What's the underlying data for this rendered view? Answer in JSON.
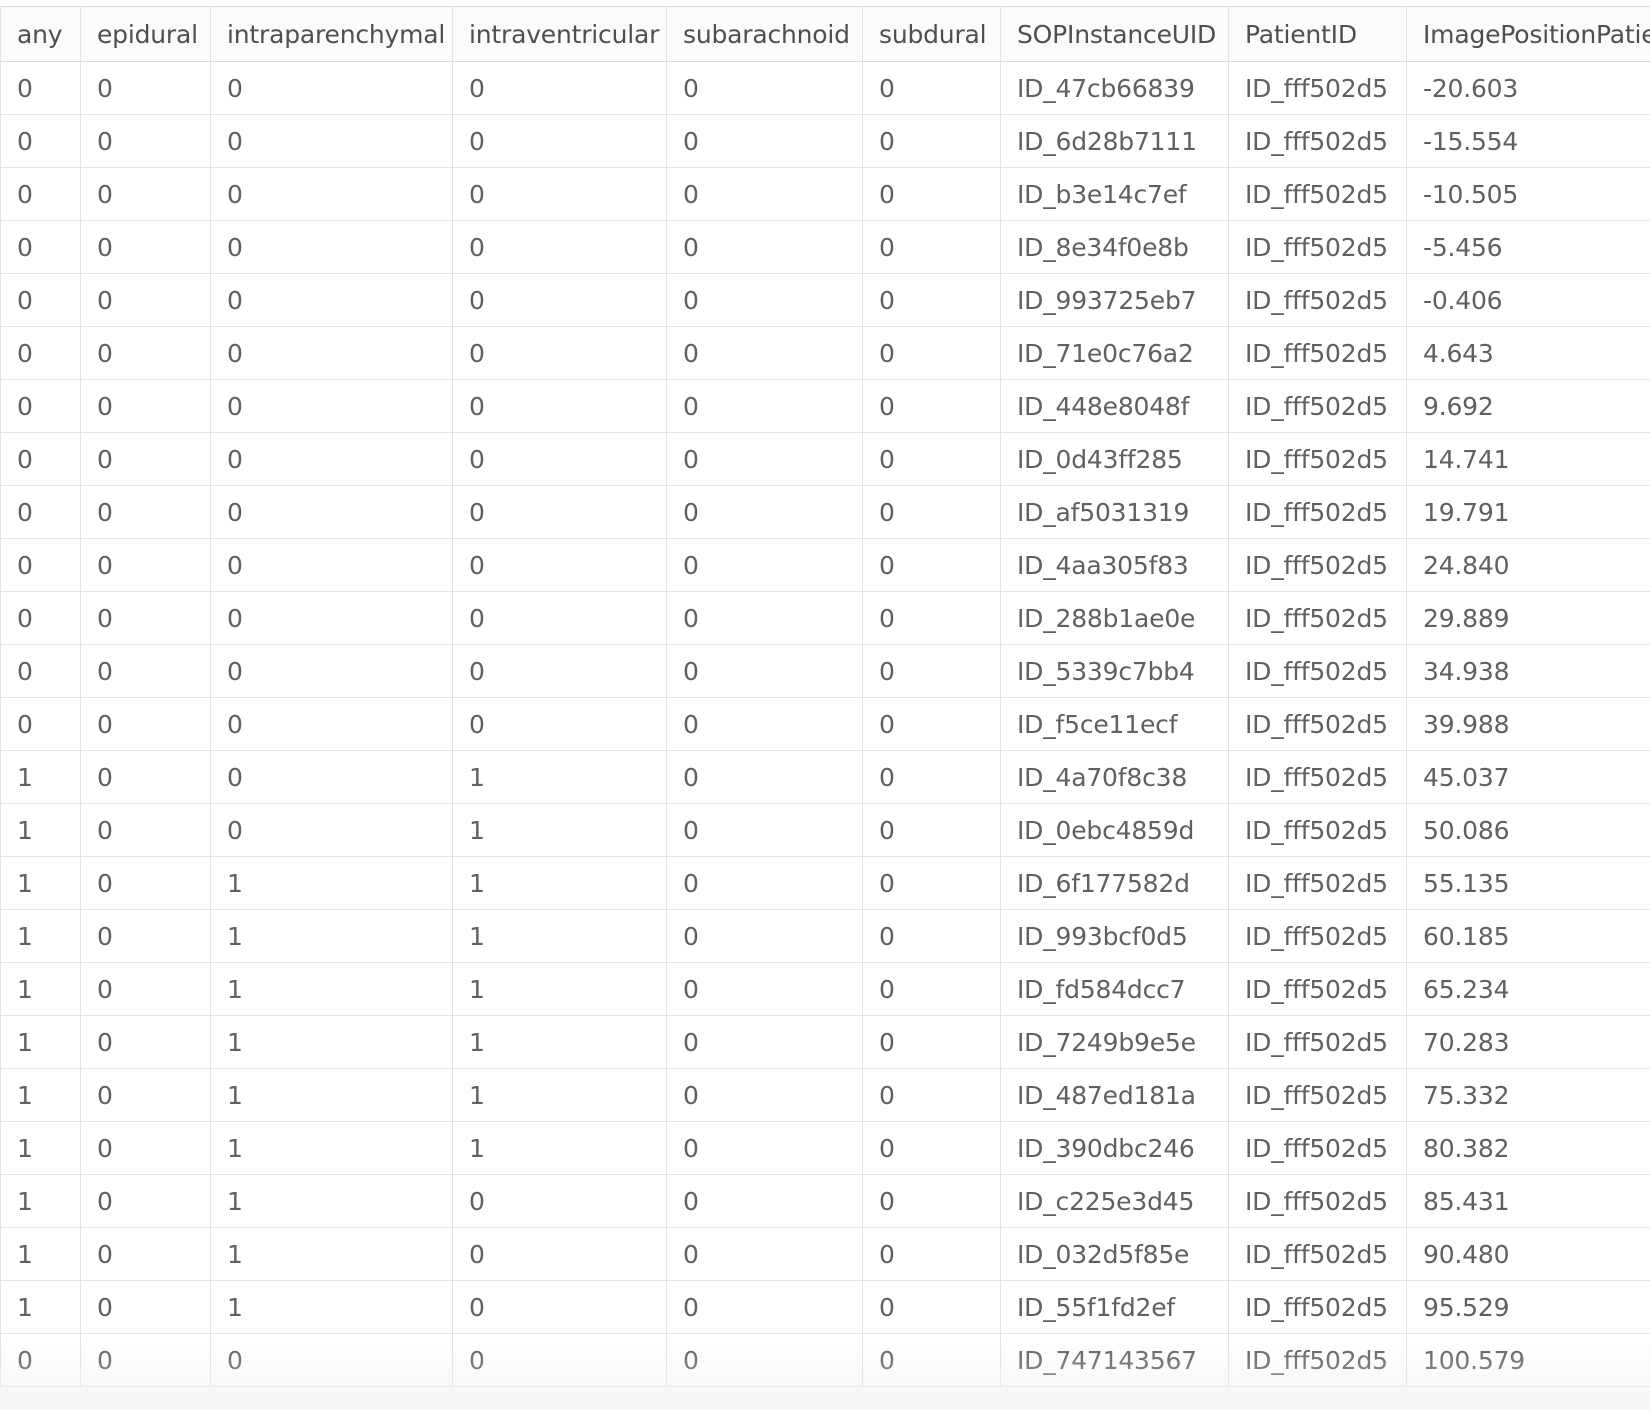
{
  "table": {
    "columns": [
      "any",
      "epidural",
      "intraparenchymal",
      "intraventricular",
      "subarachnoid",
      "subdural",
      "SOPInstanceUID",
      "PatientID",
      "ImagePositionPatie"
    ],
    "rows": [
      [
        "0",
        "0",
        "0",
        "0",
        "0",
        "0",
        "ID_47cb66839",
        "ID_fff502d5",
        "-20.603"
      ],
      [
        "0",
        "0",
        "0",
        "0",
        "0",
        "0",
        "ID_6d28b7111",
        "ID_fff502d5",
        "-15.554"
      ],
      [
        "0",
        "0",
        "0",
        "0",
        "0",
        "0",
        "ID_b3e14c7ef",
        "ID_fff502d5",
        "-10.505"
      ],
      [
        "0",
        "0",
        "0",
        "0",
        "0",
        "0",
        "ID_8e34f0e8b",
        "ID_fff502d5",
        "-5.456"
      ],
      [
        "0",
        "0",
        "0",
        "0",
        "0",
        "0",
        "ID_993725eb7",
        "ID_fff502d5",
        "-0.406"
      ],
      [
        "0",
        "0",
        "0",
        "0",
        "0",
        "0",
        "ID_71e0c76a2",
        "ID_fff502d5",
        "4.643"
      ],
      [
        "0",
        "0",
        "0",
        "0",
        "0",
        "0",
        "ID_448e8048f",
        "ID_fff502d5",
        "9.692"
      ],
      [
        "0",
        "0",
        "0",
        "0",
        "0",
        "0",
        "ID_0d43ff285",
        "ID_fff502d5",
        "14.741"
      ],
      [
        "0",
        "0",
        "0",
        "0",
        "0",
        "0",
        "ID_af5031319",
        "ID_fff502d5",
        "19.791"
      ],
      [
        "0",
        "0",
        "0",
        "0",
        "0",
        "0",
        "ID_4aa305f83",
        "ID_fff502d5",
        "24.840"
      ],
      [
        "0",
        "0",
        "0",
        "0",
        "0",
        "0",
        "ID_288b1ae0e",
        "ID_fff502d5",
        "29.889"
      ],
      [
        "0",
        "0",
        "0",
        "0",
        "0",
        "0",
        "ID_5339c7bb4",
        "ID_fff502d5",
        "34.938"
      ],
      [
        "0",
        "0",
        "0",
        "0",
        "0",
        "0",
        "ID_f5ce11ecf",
        "ID_fff502d5",
        "39.988"
      ],
      [
        "1",
        "0",
        "0",
        "1",
        "0",
        "0",
        "ID_4a70f8c38",
        "ID_fff502d5",
        "45.037"
      ],
      [
        "1",
        "0",
        "0",
        "1",
        "0",
        "0",
        "ID_0ebc4859d",
        "ID_fff502d5",
        "50.086"
      ],
      [
        "1",
        "0",
        "1",
        "1",
        "0",
        "0",
        "ID_6f177582d",
        "ID_fff502d5",
        "55.135"
      ],
      [
        "1",
        "0",
        "1",
        "1",
        "0",
        "0",
        "ID_993bcf0d5",
        "ID_fff502d5",
        "60.185"
      ],
      [
        "1",
        "0",
        "1",
        "1",
        "0",
        "0",
        "ID_fd584dcc7",
        "ID_fff502d5",
        "65.234"
      ],
      [
        "1",
        "0",
        "1",
        "1",
        "0",
        "0",
        "ID_7249b9e5e",
        "ID_fff502d5",
        "70.283"
      ],
      [
        "1",
        "0",
        "1",
        "1",
        "0",
        "0",
        "ID_487ed181a",
        "ID_fff502d5",
        "75.332"
      ],
      [
        "1",
        "0",
        "1",
        "1",
        "0",
        "0",
        "ID_390dbc246",
        "ID_fff502d5",
        "80.382"
      ],
      [
        "1",
        "0",
        "1",
        "0",
        "0",
        "0",
        "ID_c225e3d45",
        "ID_fff502d5",
        "85.431"
      ],
      [
        "1",
        "0",
        "1",
        "0",
        "0",
        "0",
        "ID_032d5f85e",
        "ID_fff502d5",
        "90.480"
      ],
      [
        "1",
        "0",
        "1",
        "0",
        "0",
        "0",
        "ID_55f1fd2ef",
        "ID_fff502d5",
        "95.529"
      ],
      [
        "0",
        "0",
        "0",
        "0",
        "0",
        "0",
        "ID_747143567",
        "ID_fff502d5",
        "100.579"
      ]
    ]
  }
}
